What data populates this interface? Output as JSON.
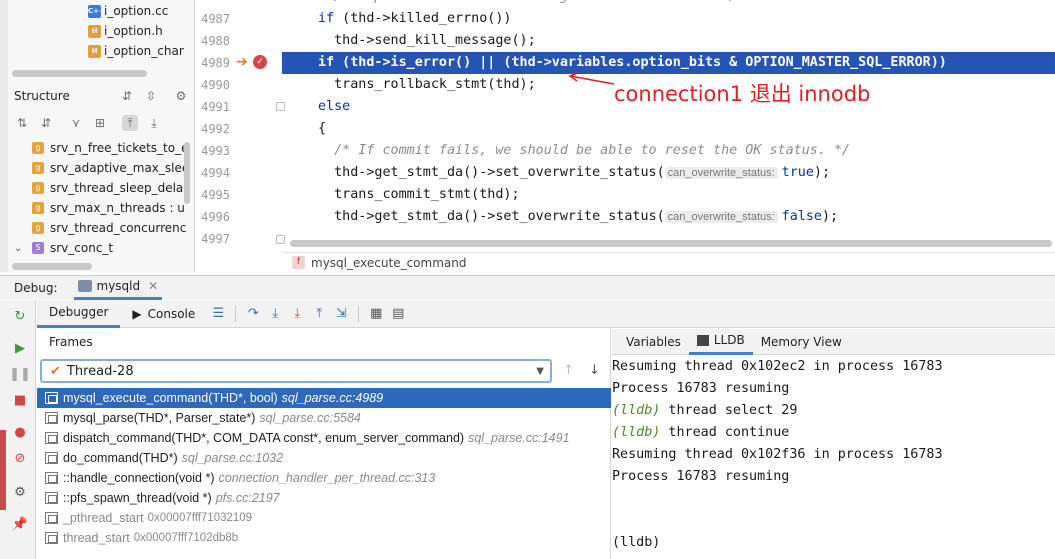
{
  "project_tree": {
    "files": [
      {
        "name": "i_option.cc",
        "type": "C++"
      },
      {
        "name": "i_option.h",
        "type": "H"
      },
      {
        "name": "i_option_char",
        "type": "H"
      }
    ]
  },
  "structure": {
    "title": "Structure",
    "items": [
      {
        "label": "srv_n_free_tickets_to_e",
        "kind": "g"
      },
      {
        "label": "srv_adaptive_max_slee",
        "kind": "g"
      },
      {
        "label": "srv_thread_sleep_dela",
        "kind": "g"
      },
      {
        "label": "srv_max_n_threads : ul",
        "kind": "g"
      },
      {
        "label": "srv_thread_concurrenc",
        "kind": "g"
      },
      {
        "label": "srv_conc_t",
        "kind": "s"
      }
    ]
  },
  "editor": {
    "lines": [
      {
        "num": "4987",
        "text_kw": "if",
        "text": " (thd->killed_errno())"
      },
      {
        "num": "4988",
        "text": "  thd->send_kill_message();"
      },
      {
        "num": "4989",
        "text": "if (thd->is_error() || (thd->variables.option_bits & OPTION_MASTER_SQL_ERROR))"
      },
      {
        "num": "4990",
        "text": "  trans_rollback_stmt(thd);"
      },
      {
        "num": "4991",
        "text_kw": "else",
        "text": ""
      },
      {
        "num": "4992",
        "text": "{"
      },
      {
        "num": "4993",
        "comment": "  /* If commit fails, we should be able to reset the OK status. */"
      },
      {
        "num": "4994",
        "pre": "  thd->get_stmt_da()->set_overwrite_status(",
        "hint": "can_overwrite_status:",
        "arg": "true",
        "post": ");"
      },
      {
        "num": "4995",
        "text": "  trans_commit_stmt(thd);"
      },
      {
        "num": "4996",
        "pre": "  thd->get_stmt_da()->set_overwrite_status(",
        "hint": "can_overwrite_status:",
        "arg": "false",
        "post": ");"
      },
      {
        "num": "4997",
        "text": ""
      }
    ],
    "breadcrumb": "mysql_execute_command",
    "annotation": "connection1 退出 innodb"
  },
  "debug": {
    "label": "Debug:",
    "session_tab": "mysqld",
    "tabs": {
      "debugger": "Debugger",
      "console": "Console"
    },
    "frames_title": "Frames",
    "thread": "Thread-28",
    "frames": [
      {
        "func": "mysql_execute_command(THD*, bool)",
        "loc": "sql_parse.cc:4989",
        "selected": true
      },
      {
        "func": "mysql_parse(THD*, Parser_state*)",
        "loc": "sql_parse.cc:5584"
      },
      {
        "func": "dispatch_command(THD*, COM_DATA const*, enum_server_command)",
        "loc": "sql_parse.cc:1491"
      },
      {
        "func": "do_command(THD*)",
        "loc": "sql_parse.cc:1032"
      },
      {
        "func": "::handle_connection(void *)",
        "loc": "connection_handler_per_thread.cc:313"
      },
      {
        "func": "::pfs_spawn_thread(void *)",
        "loc": "pfs.cc:2197"
      },
      {
        "func": "_pthread_start",
        "addr": "0x00007fff71032109",
        "dim": true
      },
      {
        "func": "thread_start",
        "addr": "0x00007fff7102db8b",
        "dim": true
      }
    ],
    "right_tabs": {
      "variables": "Variables",
      "lldb": "LLDB",
      "memory": "Memory View"
    },
    "console_lines": [
      {
        "text": "Resuming thread 0x102ec2 in process 16783"
      },
      {
        "text": "Process 16783 resuming"
      },
      {
        "prompt": "(lldb)",
        "text": " thread select 29"
      },
      {
        "prompt": "(lldb)",
        "text": " thread continue"
      },
      {
        "text": "Resuming thread 0x102f36 in process 16783"
      },
      {
        "text": "Process 16783 resuming"
      },
      {
        "text": ""
      },
      {
        "text": ""
      },
      {
        "prompt": "(lldb)",
        "text": ""
      }
    ]
  },
  "colors": {
    "accent": "#4083c9",
    "selection": "#2e68bd",
    "annotation": "#e02020",
    "keyword": "#0033b3"
  }
}
